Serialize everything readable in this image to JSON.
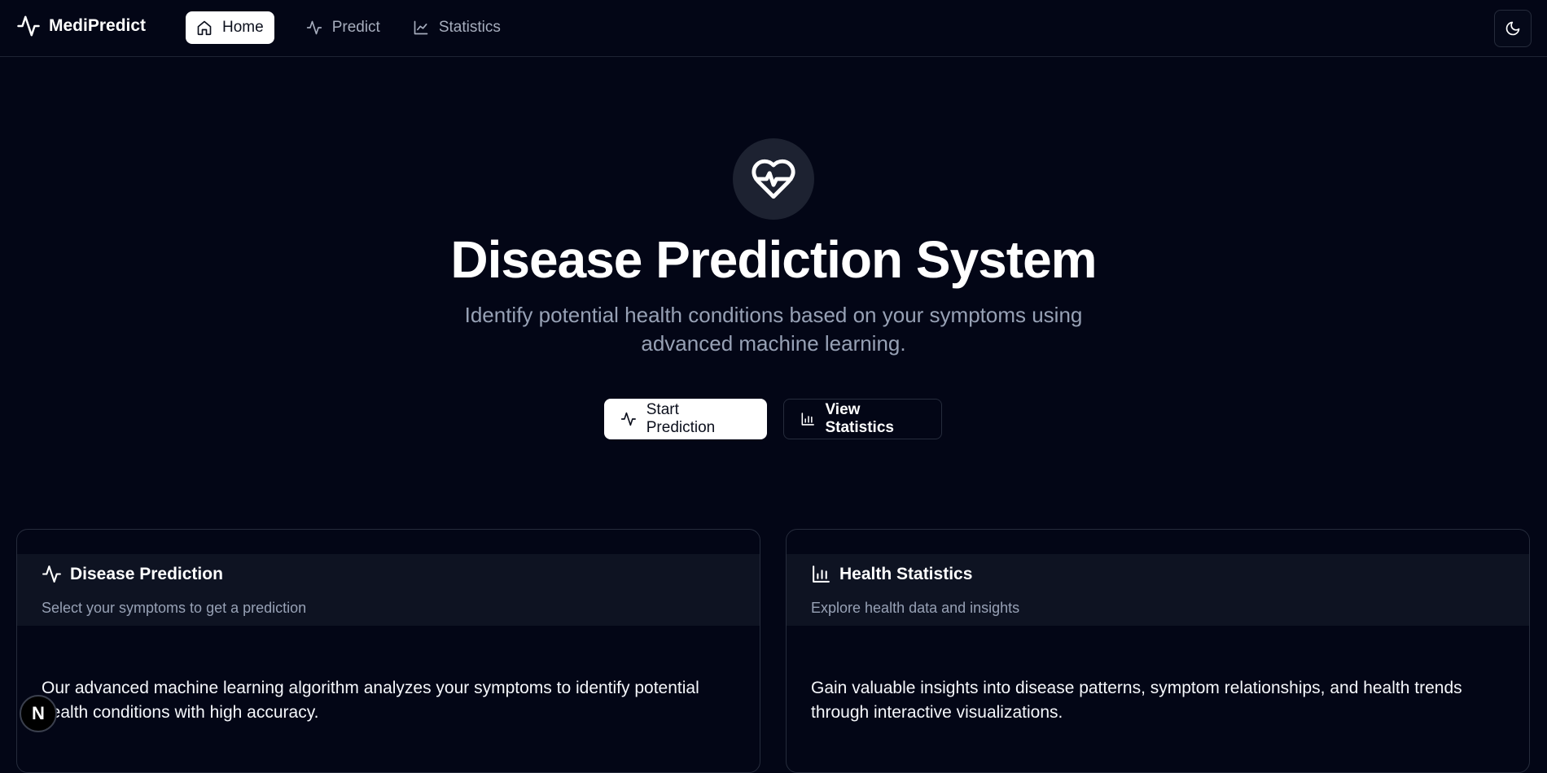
{
  "brand": {
    "name": "MediPredict",
    "icon": "activity-icon"
  },
  "nav": {
    "items": [
      {
        "label": "Home",
        "icon": "home-icon",
        "active": true
      },
      {
        "label": "Predict",
        "icon": "activity-icon",
        "active": false
      },
      {
        "label": "Statistics",
        "icon": "line-chart-icon",
        "active": false
      }
    ],
    "theme_toggle_icon": "moon-icon"
  },
  "hero": {
    "icon": "heart-pulse-icon",
    "title": "Disease Prediction System",
    "subtitle": "Identify potential health conditions based on your symptoms using advanced machine learning.",
    "primary_button": "Start Prediction",
    "secondary_button": "View Statistics"
  },
  "cards": [
    {
      "title": "Disease Prediction",
      "icon": "activity-icon",
      "description": "Select your symptoms to get a prediction",
      "body": "Our advanced machine learning algorithm analyzes your symptoms to identify potential health conditions with high accuracy."
    },
    {
      "title": "Health Statistics",
      "icon": "bar-chart-icon",
      "description": "Explore health data and insights",
      "body": "Gain valuable insights into disease patterns, symptom relationships, and health trends through interactive visualizations."
    }
  ],
  "badge": {
    "letter": "N"
  },
  "colors": {
    "background": "#030616",
    "card_header": "#0e1322",
    "muted_text": "#97a1b5",
    "border": "#262c3c"
  }
}
